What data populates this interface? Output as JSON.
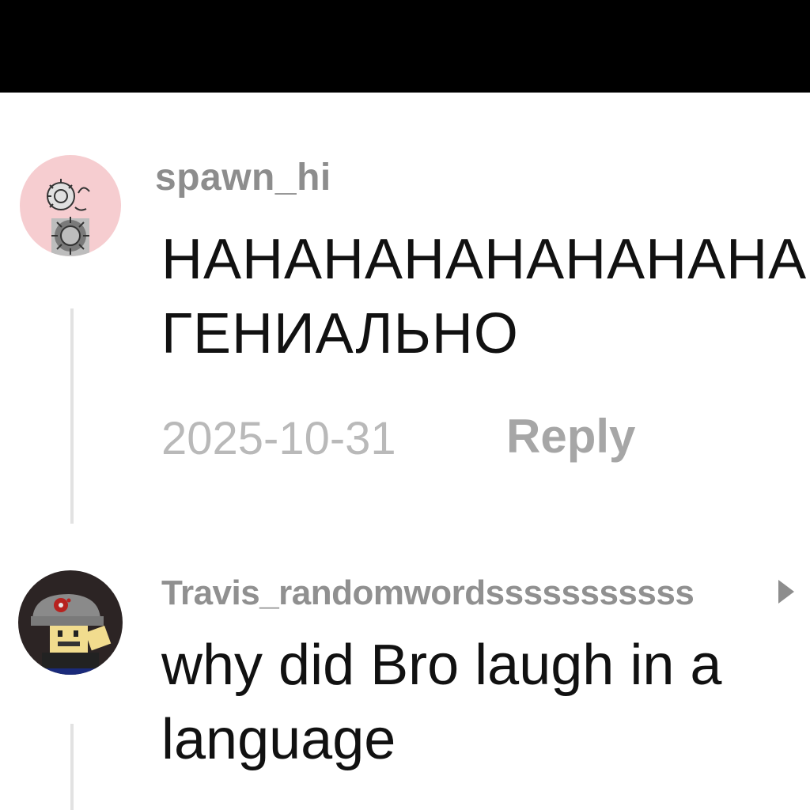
{
  "comments": [
    {
      "username": "spawn_hi",
      "text_lines": [
        "НАНАНАНАНАНАНАНА",
        "ГЕНИАЛЬНО"
      ],
      "date": "2025-10-31",
      "reply_label": "Reply"
    },
    {
      "username": "Travis_randomwordsssssssssss",
      "text_lines": [
        "why did Bro laugh in a",
        "language"
      ]
    }
  ],
  "icons": {
    "avatar_1": "gear-character-avatar",
    "avatar_2": "blocky-character-avatar",
    "arrow": "play-arrow-icon"
  },
  "colors": {
    "top_bar": "#000000",
    "username": "#8d8d8d",
    "text": "#111111",
    "meta": "#b9b9b9",
    "reply": "#a6a6a6",
    "thread_line": "#e2e2e2",
    "avatar_1_bg": "#f6cdd0",
    "avatar_2_bg": "#2c2424"
  }
}
